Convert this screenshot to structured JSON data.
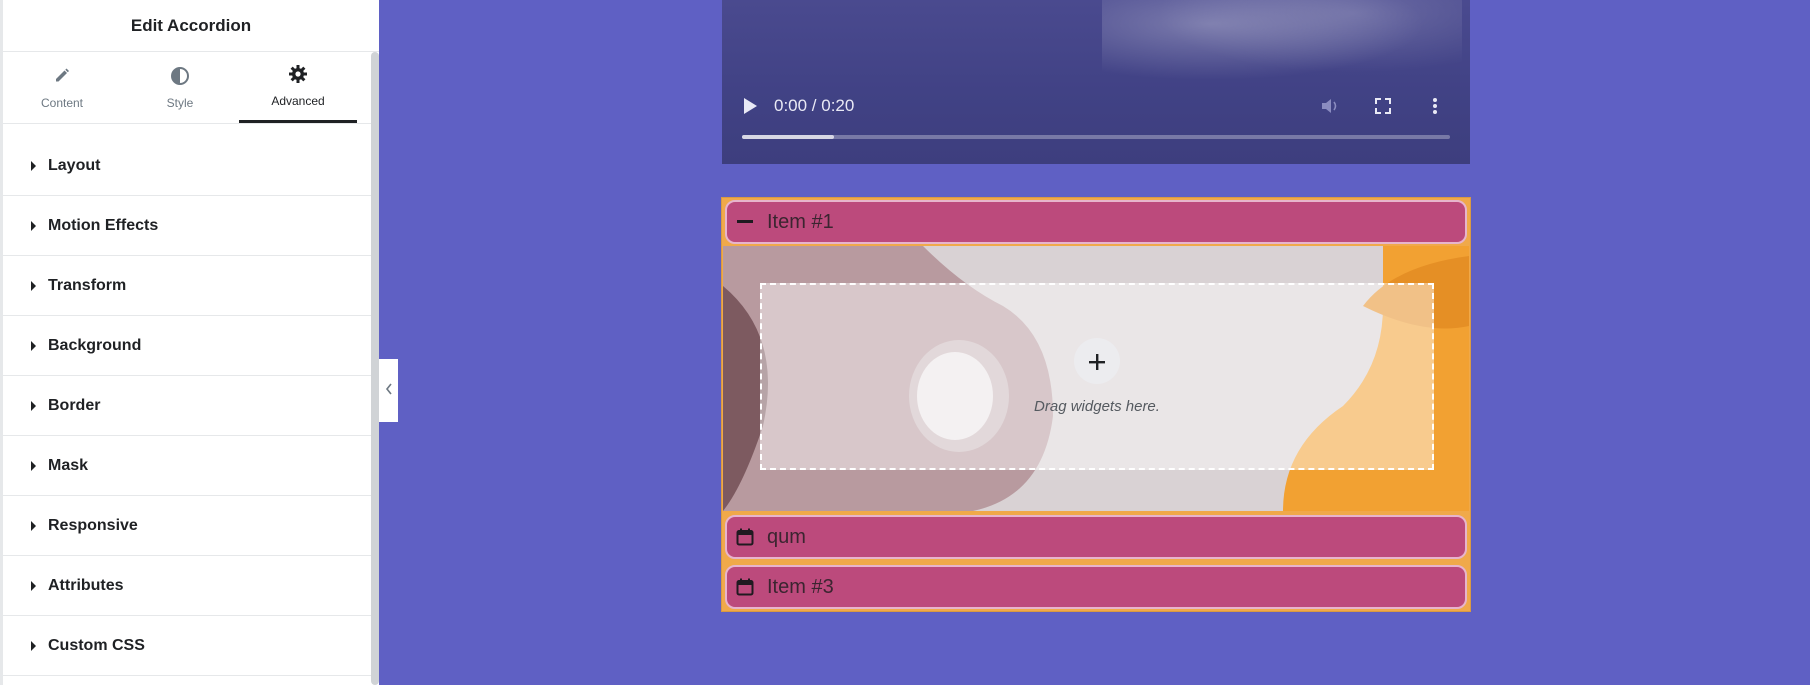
{
  "panel": {
    "title": "Edit Accordion",
    "tabs": [
      {
        "label": "Content",
        "icon": "pencil-icon"
      },
      {
        "label": "Style",
        "icon": "contrast-icon"
      },
      {
        "label": "Advanced",
        "icon": "gear-icon"
      }
    ],
    "active_tab": "Advanced",
    "sections": [
      {
        "label": "Layout"
      },
      {
        "label": "Motion Effects"
      },
      {
        "label": "Transform"
      },
      {
        "label": "Background"
      },
      {
        "label": "Border"
      },
      {
        "label": "Mask"
      },
      {
        "label": "Responsive"
      },
      {
        "label": "Attributes"
      },
      {
        "label": "Custom CSS"
      }
    ],
    "collapse_icon": "chevron-left-icon"
  },
  "video": {
    "time": "0:00 / 0:20",
    "progress_fraction": 0.13
  },
  "accordion": {
    "items": [
      {
        "title": "Item #1",
        "icon": "minus-icon",
        "expanded": true
      },
      {
        "title": "qum",
        "icon": "calendar-icon",
        "expanded": false
      },
      {
        "title": "Item #3",
        "icon": "calendar-icon",
        "expanded": false
      }
    ],
    "dropzone_text": "Drag widgets here."
  },
  "colors": {
    "canvas_bg": "#5f60c4",
    "accordion_title_bg": "#bc4a7c",
    "accordion_border": "#f0a94a"
  }
}
